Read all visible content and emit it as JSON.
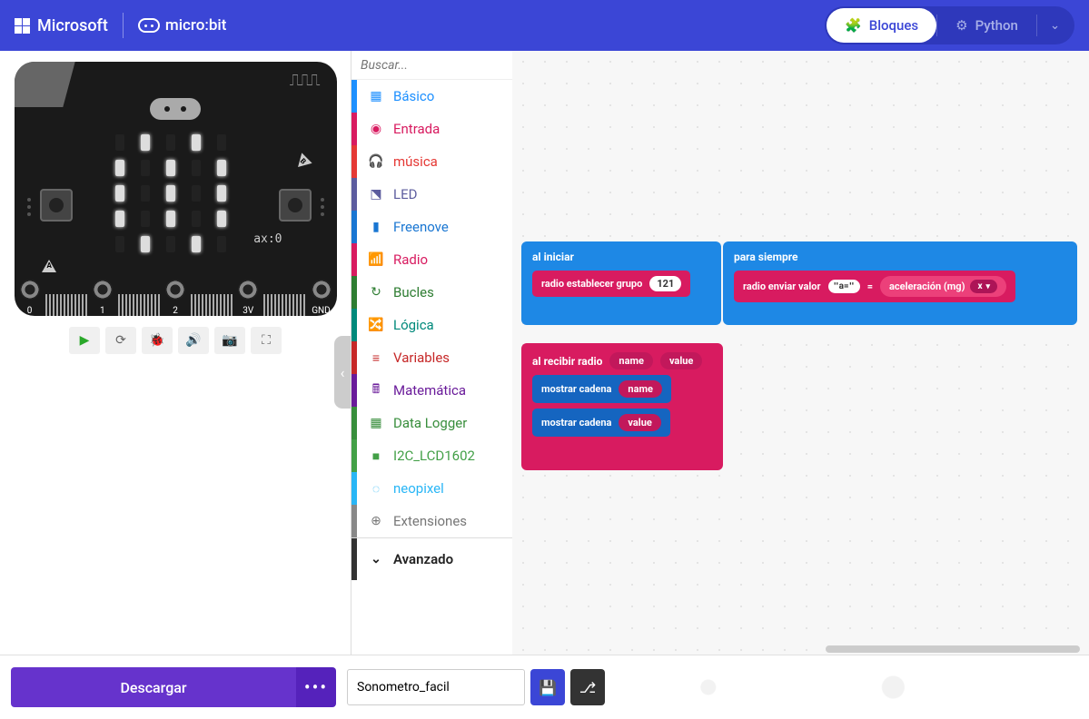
{
  "header": {
    "ms_label": "Microsoft",
    "mb_label": "micro:bit",
    "blocks_label": "Bloques",
    "python_label": "Python"
  },
  "simulator": {
    "ax_label": "ax:0",
    "pins": [
      "0",
      "1",
      "2",
      "3V",
      "GND"
    ]
  },
  "toolbox": {
    "search_placeholder": "Buscar...",
    "categories": [
      {
        "key": "basico",
        "label": "Básico"
      },
      {
        "key": "entrada",
        "label": "Entrada"
      },
      {
        "key": "musica",
        "label": "música"
      },
      {
        "key": "led",
        "label": "LED"
      },
      {
        "key": "freenove",
        "label": "Freenove"
      },
      {
        "key": "radio",
        "label": "Radio"
      },
      {
        "key": "bucles",
        "label": "Bucles"
      },
      {
        "key": "logica",
        "label": "Lógica"
      },
      {
        "key": "variables",
        "label": "Variables"
      },
      {
        "key": "matematica",
        "label": "Matemática"
      },
      {
        "key": "datalogger",
        "label": "Data Logger"
      },
      {
        "key": "i2c",
        "label": "I2C_LCD1602"
      },
      {
        "key": "neopixel",
        "label": "neopixel"
      },
      {
        "key": "ext",
        "label": "Extensiones"
      }
    ],
    "advanced_label": "Avanzado"
  },
  "blocks": {
    "on_start": {
      "title": "al iniciar",
      "radio_set_group": "radio establecer grupo",
      "group_value": "121"
    },
    "forever": {
      "title": "para siempre",
      "radio_send_value": "radio enviar valor",
      "key": "a=",
      "equals": "=",
      "accel_label": "aceleración (mg)",
      "axis": "x"
    },
    "on_radio": {
      "title": "al recibir radio",
      "param_name": "name",
      "param_value": "value",
      "show_string": "mostrar cadena",
      "arg1": "name",
      "arg2": "value"
    }
  },
  "bottom": {
    "download_label": "Descargar",
    "project_name": "Sonometro_facil"
  }
}
